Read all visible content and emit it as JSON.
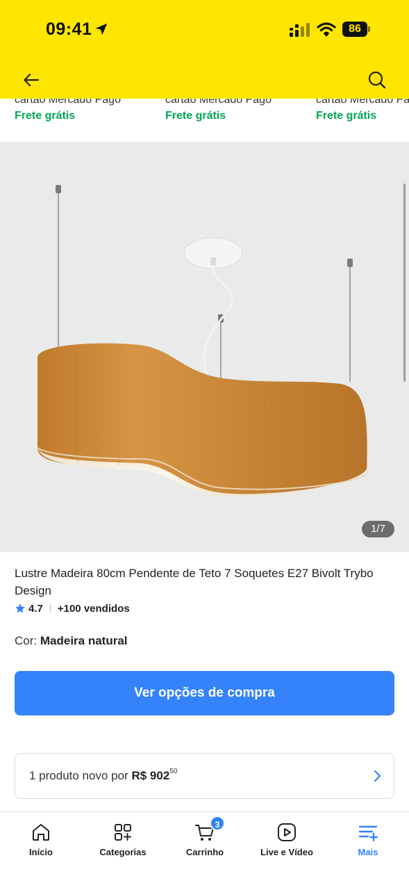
{
  "status_bar": {
    "time": "09:41",
    "battery": "86",
    "icons": [
      "location-arrow-icon",
      "signal-icon",
      "wifi-icon",
      "battery-icon"
    ]
  },
  "nav": {
    "back_icon": "arrow-left-icon",
    "search_icon": "search-icon"
  },
  "related": [
    {
      "payment": "cartão Mercado Pago",
      "shipping": "Frete grátis"
    },
    {
      "payment": "cartão Mercado Pago",
      "shipping": "Frete grátis"
    },
    {
      "payment": "cartão Mercado Pa",
      "shipping": "Frete grátis"
    }
  ],
  "gallery": {
    "counter": "1/7",
    "colors": {
      "background": "#e9ebea",
      "wood": "#c98a3a",
      "inner": "#f6eee2"
    }
  },
  "product": {
    "title": "Lustre Madeira 80cm Pendente de Teto 7 Soquetes E27 Bivolt Trybo Design",
    "rating": "4.7",
    "sold": "+100 vendidos",
    "color_label": "Cor:",
    "color_value": "Madeira natural",
    "cta": "Ver opções de compra"
  },
  "offer": {
    "prefix": "1 produto novo por",
    "price": "R$ 902",
    "cents": "50"
  },
  "tabs": [
    {
      "label": "Início",
      "icon": "home-icon"
    },
    {
      "label": "Categorias",
      "icon": "categories-icon"
    },
    {
      "label": "Carrinho",
      "icon": "cart-icon",
      "badge": "3"
    },
    {
      "label": "Live e Vídeo",
      "icon": "play-icon"
    },
    {
      "label": "Mais",
      "icon": "menu-plus-icon",
      "active": true
    }
  ],
  "colors": {
    "brand_yellow": "#ffe600",
    "accent_blue": "#3483fa",
    "shipping_green": "#00a650"
  }
}
